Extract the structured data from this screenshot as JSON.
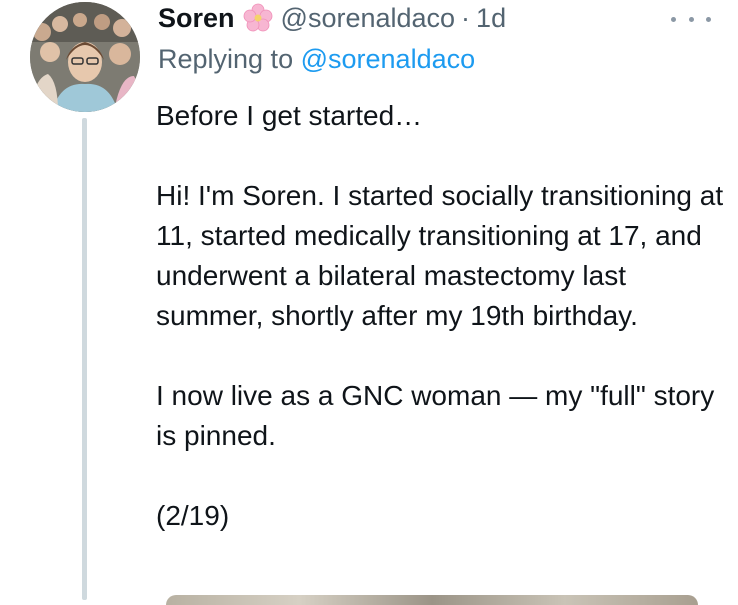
{
  "tweet": {
    "author": {
      "display_name": "Soren",
      "handle": "@sorenaldaco",
      "separator": "·",
      "timestamp": "1d",
      "name_emoji": "cherry-blossom-icon"
    },
    "reply_to": {
      "prefix": "Replying to",
      "handle": "@sorenaldaco"
    },
    "body": {
      "line1": "Before I get started…",
      "para2": "Hi! I'm Soren. I started socially transitioning at 11, started medically transitioning at 17, and underwent a bilateral mastectomy last summer, shortly after my 19th birthday.",
      "para3": "I now live as a GNC woman — my \"full\" story is pinned.",
      "counter": "(2/19)"
    }
  },
  "colors": {
    "text_primary": "#0f1419",
    "text_secondary": "#536471",
    "link": "#1d9bf0",
    "thread_line": "#cfd9de"
  }
}
